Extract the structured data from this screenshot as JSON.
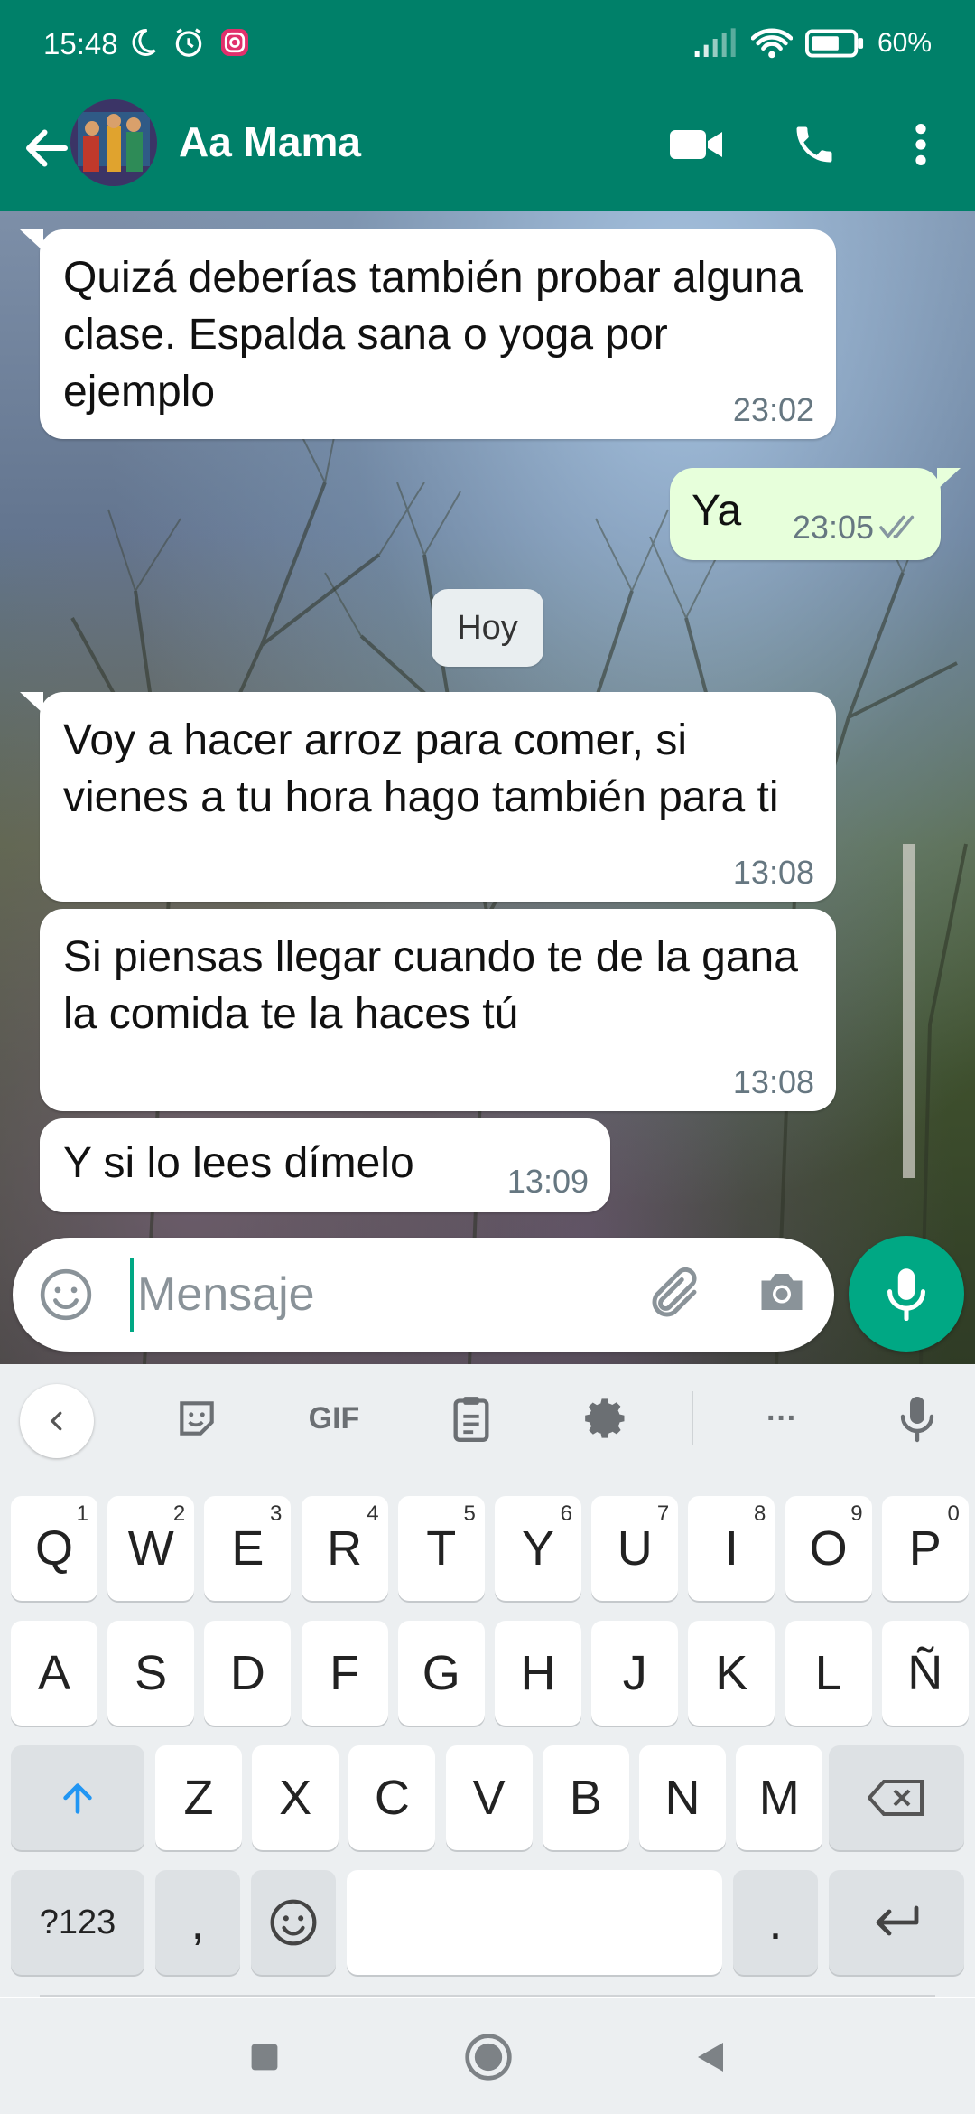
{
  "status_bar": {
    "time": "15:48",
    "battery": "60%"
  },
  "header": {
    "contact_name": "Aa Mama"
  },
  "messages": [
    {
      "direction": "in",
      "text": "Quizá deberías también probar alguna clase. Espalda sana o yoga por ejemplo",
      "time": "23:02"
    },
    {
      "direction": "out",
      "text": "Ya",
      "time": "23:05",
      "status": "read"
    },
    {
      "direction": "in",
      "text": "Voy a hacer arroz para comer, si vienes a tu hora hago también para ti",
      "time": "13:08"
    },
    {
      "direction": "in",
      "text": "Si piensas llegar cuando te de la gana la comida te la haces tú",
      "time": "13:08"
    },
    {
      "direction": "in",
      "text": "Y si lo lees dímelo",
      "time": "13:09"
    }
  ],
  "date_divider": "Hoy",
  "composer": {
    "placeholder": "Mensaje"
  },
  "keyboard": {
    "toolbar": {
      "gif_label": "GIF",
      "more_label": "···"
    },
    "row1": [
      {
        "key": "Q",
        "hint": "1"
      },
      {
        "key": "W",
        "hint": "2"
      },
      {
        "key": "E",
        "hint": "3"
      },
      {
        "key": "R",
        "hint": "4"
      },
      {
        "key": "T",
        "hint": "5"
      },
      {
        "key": "Y",
        "hint": "6"
      },
      {
        "key": "U",
        "hint": "7"
      },
      {
        "key": "I",
        "hint": "8"
      },
      {
        "key": "O",
        "hint": "9"
      },
      {
        "key": "P",
        "hint": "0"
      }
    ],
    "row2": [
      "A",
      "S",
      "D",
      "F",
      "G",
      "H",
      "J",
      "K",
      "L",
      "Ñ"
    ],
    "row3": [
      "Z",
      "X",
      "C",
      "V",
      "B",
      "N",
      "M"
    ],
    "row4": {
      "symbols": "?123",
      "comma": ",",
      "period": "."
    }
  },
  "colors": {
    "brand": "#008069",
    "accent": "#00a884",
    "outgoing_bubble": "#e7ffdb",
    "read_check": "#8696a0"
  }
}
